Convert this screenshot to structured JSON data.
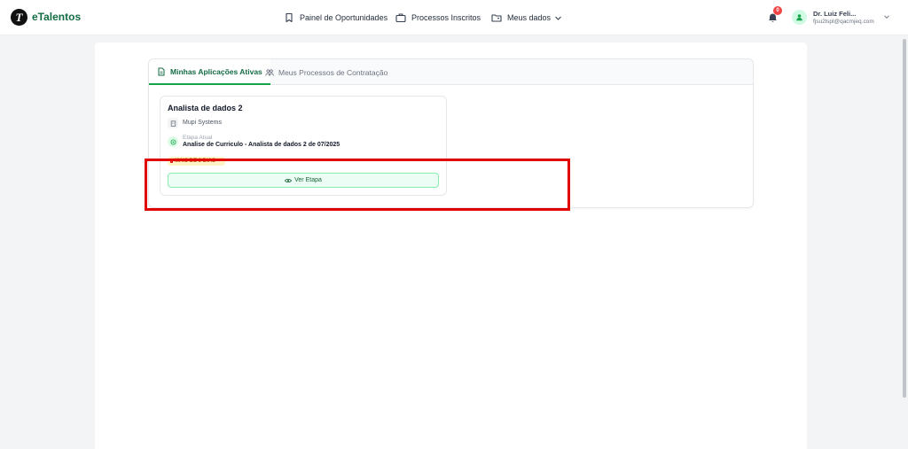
{
  "header": {
    "logo_letter": "T",
    "brand": "eTalentos",
    "nav": {
      "opportunities": "Painel de Oportunidades",
      "processes": "Processos Inscritos",
      "my_data": "Meus dados"
    },
    "notification_count": "0",
    "user": {
      "name": "Dr. Luiz Feli...",
      "email": "fjsu2lspl@qacmjeq.com"
    }
  },
  "tabs": {
    "active": "Minhas Aplicações Ativas",
    "inactive": "Meus Processos de Contratação"
  },
  "job": {
    "title": "Analista de dados 2",
    "company": "Mupi Systems",
    "stage_label": "Etapa Atual",
    "stage_value": "Analise de Curriculo - Analista de dados 2 de 07/2025",
    "status": "MAIS DE 3 DIAS",
    "view_button": "Ver Etapa"
  },
  "colors": {
    "brand": "#146c43",
    "accent": "#16a34a",
    "highlight": "#e00000",
    "badge": "#ef4444"
  }
}
